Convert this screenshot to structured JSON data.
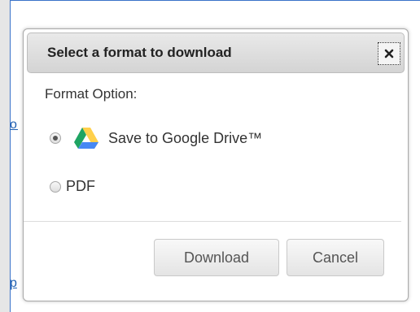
{
  "dialog": {
    "title": "Select a format to download",
    "close_icon": "close-x-icon",
    "format_label": "Format Option:",
    "options": [
      {
        "label": "Save to Google Drive™",
        "icon": "google-drive-icon",
        "selected": true
      },
      {
        "label": "PDF",
        "selected": false
      }
    ],
    "download_label": "Download",
    "cancel_label": "Cancel"
  },
  "background": {
    "link_1": "or",
    "link_2": "p"
  },
  "colors": {
    "drive_green": "#1fa463",
    "drive_yellow": "#ffd04b",
    "drive_blue": "#4688f4",
    "link_blue": "#1f5fb0"
  }
}
